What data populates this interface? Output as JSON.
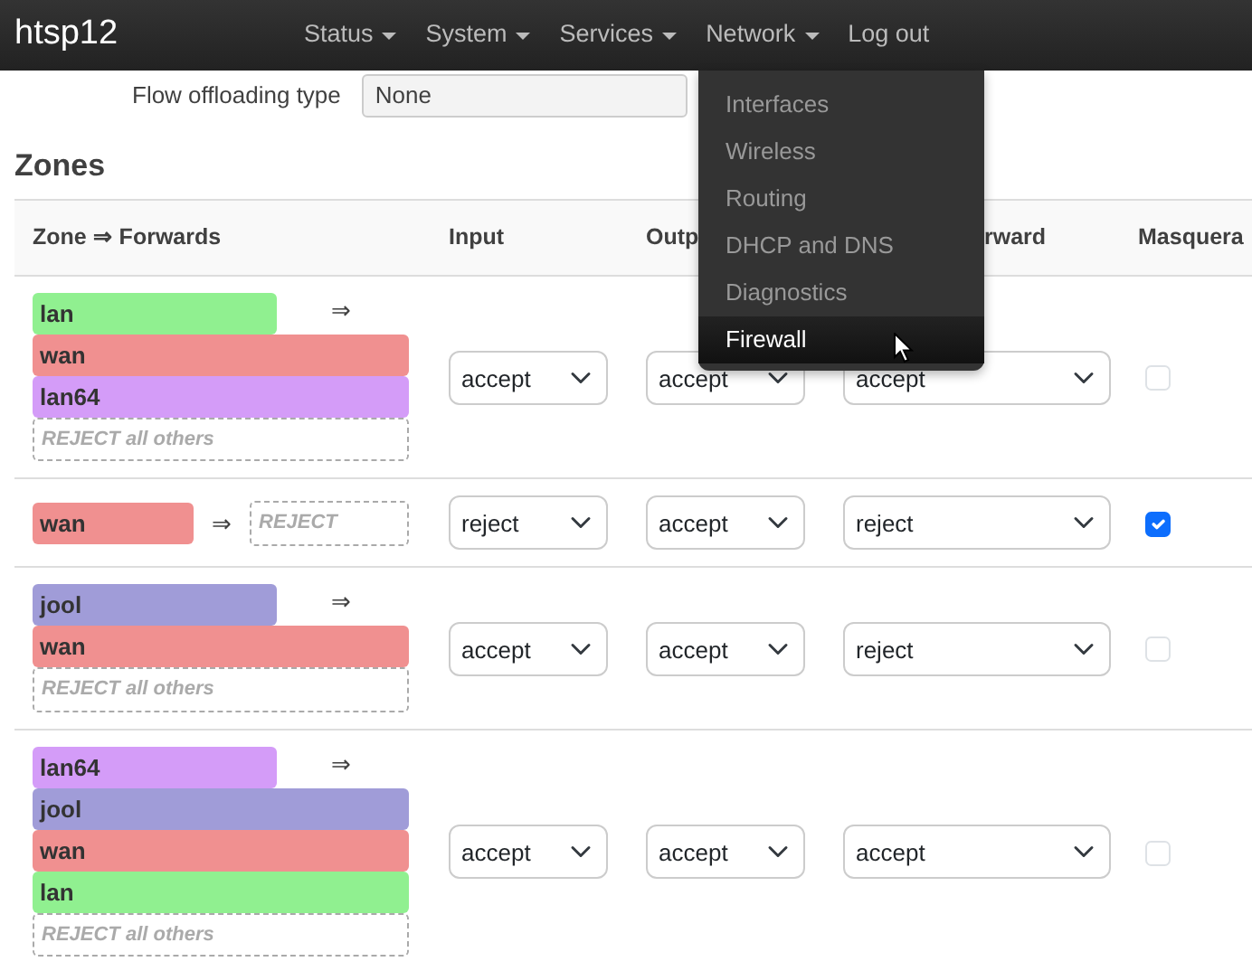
{
  "navbar": {
    "brand": "htsp12",
    "menus": [
      {
        "label": "Status",
        "dropdown": true,
        "open": false
      },
      {
        "label": "System",
        "dropdown": true,
        "open": false
      },
      {
        "label": "Services",
        "dropdown": true,
        "open": false
      },
      {
        "label": "Network",
        "dropdown": true,
        "open": true,
        "items": [
          {
            "label": "Interfaces",
            "selected": false
          },
          {
            "label": "Wireless",
            "selected": false
          },
          {
            "label": "Routing",
            "selected": false
          },
          {
            "label": "DHCP and DNS",
            "selected": false
          },
          {
            "label": "Diagnostics",
            "selected": false
          },
          {
            "label": "Firewall",
            "selected": true
          }
        ]
      },
      {
        "label": "Log out",
        "dropdown": false,
        "open": false
      }
    ]
  },
  "flow_offloading": {
    "label": "Flow offloading type",
    "value": "None"
  },
  "zones": {
    "title": "Zones",
    "columns": [
      "Zone ⇒ Forwards",
      "Input",
      "Outp",
      "rward",
      "Masquera"
    ],
    "rows": [
      {
        "zone": {
          "name": "lan",
          "color": "#90f090"
        },
        "forwards": [
          {
            "name": "wan",
            "color": "#f09090"
          },
          {
            "name": "lan64",
            "color": "#d49cf8"
          }
        ],
        "arrow": "⇒",
        "fallback": "REJECT all others",
        "input": "accept",
        "output": "accept",
        "forward": "accept",
        "masquerade": false
      },
      {
        "zone": {
          "name": "wan",
          "color": "#f09090"
        },
        "forwards": [],
        "inline_arrow": "⇒",
        "inline_fallback": "REJECT",
        "input": "reject",
        "output": "accept",
        "forward": "reject",
        "masquerade": true
      },
      {
        "zone": {
          "name": "jool",
          "color": "#a09cd8"
        },
        "forwards": [
          {
            "name": "wan",
            "color": "#f09090"
          }
        ],
        "arrow": "⇒",
        "fallback": "REJECT all others",
        "input": "accept",
        "output": "accept",
        "forward": "reject",
        "masquerade": false
      },
      {
        "zone": {
          "name": "lan64",
          "color": "#d49cf8"
        },
        "forwards": [
          {
            "name": "jool",
            "color": "#a09cd8"
          },
          {
            "name": "wan",
            "color": "#f09090"
          },
          {
            "name": "lan",
            "color": "#90f090"
          }
        ],
        "arrow": "⇒",
        "fallback": "REJECT all others",
        "input": "accept",
        "output": "accept",
        "forward": "accept",
        "masquerade": false
      }
    ]
  }
}
